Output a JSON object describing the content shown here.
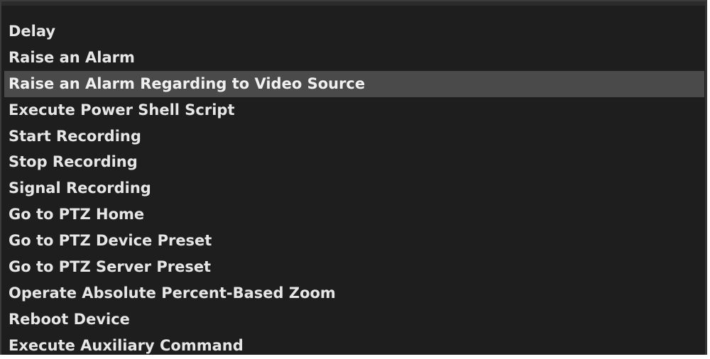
{
  "action_list": {
    "items": [
      {
        "label": "Delay",
        "selected": false
      },
      {
        "label": "Raise an Alarm",
        "selected": false
      },
      {
        "label": "Raise an Alarm Regarding to Video Source",
        "selected": true
      },
      {
        "label": "Execute Power Shell Script",
        "selected": false
      },
      {
        "label": "Start Recording",
        "selected": false
      },
      {
        "label": "Stop Recording",
        "selected": false
      },
      {
        "label": "Signal Recording",
        "selected": false
      },
      {
        "label": "Go to PTZ Home",
        "selected": false
      },
      {
        "label": "Go to PTZ Device Preset",
        "selected": false
      },
      {
        "label": "Go to PTZ Server Preset",
        "selected": false
      },
      {
        "label": "Operate Absolute Percent-Based Zoom",
        "selected": false
      },
      {
        "label": "Reboot Device",
        "selected": false
      },
      {
        "label": "Execute Auxiliary Command",
        "selected": false
      }
    ]
  }
}
